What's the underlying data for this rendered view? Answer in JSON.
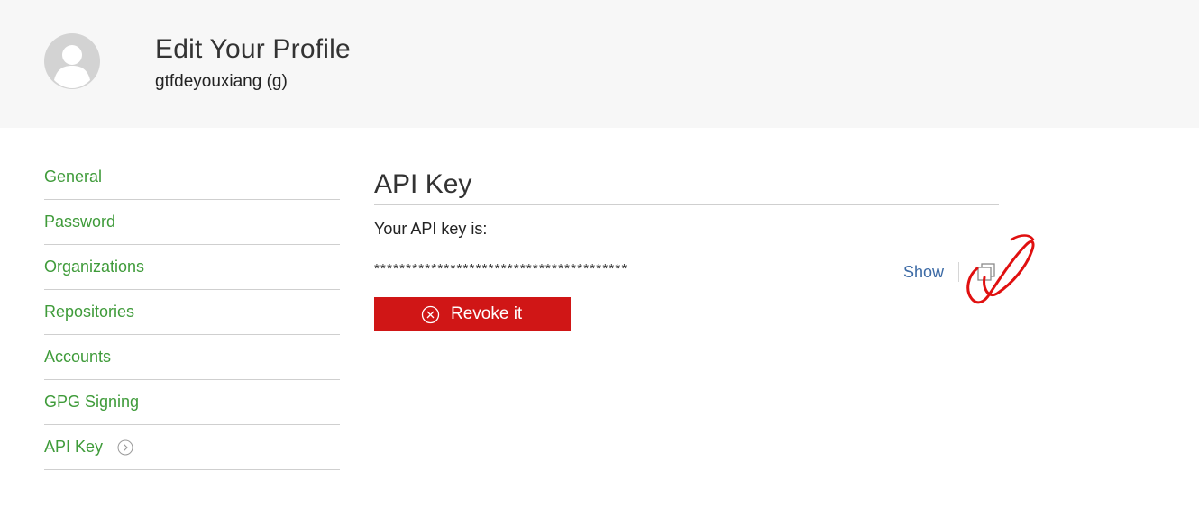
{
  "header": {
    "title": "Edit Your Profile",
    "username": "gtfdeyouxiang (g)",
    "avatar_icon": "user-avatar-icon"
  },
  "sidebar": {
    "items": [
      {
        "label": "General"
      },
      {
        "label": "Password"
      },
      {
        "label": "Organizations"
      },
      {
        "label": "Repositories"
      },
      {
        "label": "Accounts"
      },
      {
        "label": "GPG Signing"
      },
      {
        "label": "API Key",
        "active": true
      }
    ]
  },
  "main": {
    "section_title": "API Key",
    "api_label": "Your API key is:",
    "api_key_masked": "****************************************",
    "show_label": "Show",
    "copy_icon": "copy-icon",
    "revoke_label": "Revoke it"
  },
  "colors": {
    "link_green": "#3f9b3a",
    "show_blue": "#3c6aa5",
    "revoke_red": "#d01616",
    "header_bg": "#f7f7f7",
    "annotation_red": "#e01010"
  }
}
